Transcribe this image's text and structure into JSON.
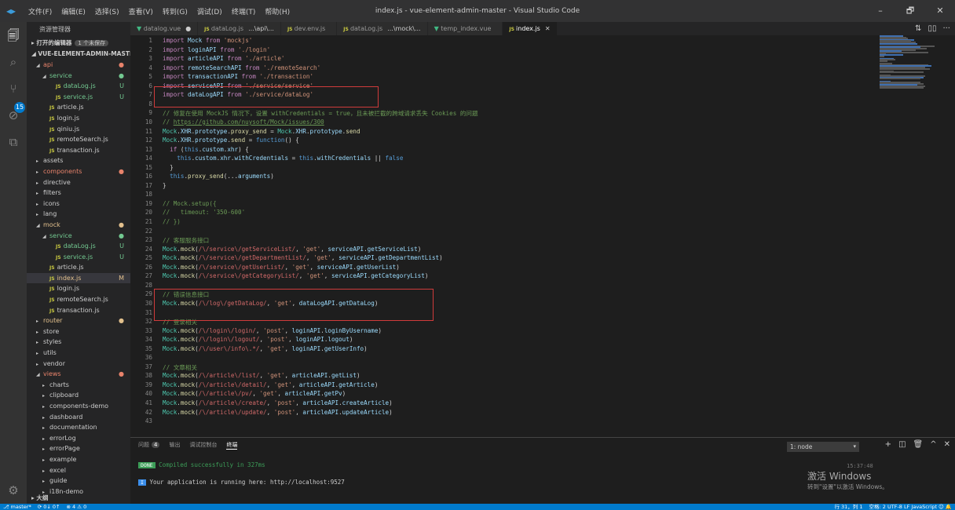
{
  "window": {
    "title": "index.js - vue-element-admin-master - Visual Studio Code",
    "menu": [
      "文件(F)",
      "编辑(E)",
      "选择(S)",
      "查看(V)",
      "转到(G)",
      "调试(D)",
      "终端(T)",
      "帮助(H)"
    ],
    "controls": {
      "minimize": "–",
      "maximize": "🗗",
      "close": "✕"
    }
  },
  "activitybar": {
    "scm_badge": "15"
  },
  "sidebar": {
    "title": "资源管理器",
    "open_editors": "▸ 打开的编辑器",
    "open_editors_badge": "1 个未保存",
    "project": "◢ VUE-ELEMENT-ADMIN-MASTER",
    "items": [
      {
        "label": "api",
        "indent": 1,
        "twisty": "◢",
        "js": false,
        "status": "●",
        "color": "err"
      },
      {
        "label": "service",
        "indent": 2,
        "twisty": "◢",
        "js": false,
        "status": "●",
        "color": "dot"
      },
      {
        "label": "dataLog.js",
        "indent": 3,
        "twisty": "",
        "js": true,
        "status": "U",
        "color": "unt"
      },
      {
        "label": "service.js",
        "indent": 3,
        "twisty": "",
        "js": true,
        "status": "U",
        "color": "unt"
      },
      {
        "label": "article.js",
        "indent": 2,
        "twisty": "",
        "js": true,
        "status": "",
        "color": "plain"
      },
      {
        "label": "login.js",
        "indent": 2,
        "twisty": "",
        "js": true,
        "status": "",
        "color": "plain"
      },
      {
        "label": "qiniu.js",
        "indent": 2,
        "twisty": "",
        "js": true,
        "status": "",
        "color": "plain"
      },
      {
        "label": "remoteSearch.js",
        "indent": 2,
        "twisty": "",
        "js": true,
        "status": "",
        "color": "plain"
      },
      {
        "label": "transaction.js",
        "indent": 2,
        "twisty": "",
        "js": true,
        "status": "",
        "color": "plain"
      },
      {
        "label": "assets",
        "indent": 1,
        "twisty": "▸",
        "js": false,
        "status": "",
        "color": "plain"
      },
      {
        "label": "components",
        "indent": 1,
        "twisty": "▸",
        "js": false,
        "status": "●",
        "color": "err"
      },
      {
        "label": "directive",
        "indent": 1,
        "twisty": "▸",
        "js": false,
        "status": "",
        "color": "plain"
      },
      {
        "label": "filters",
        "indent": 1,
        "twisty": "▸",
        "js": false,
        "status": "",
        "color": "plain"
      },
      {
        "label": "icons",
        "indent": 1,
        "twisty": "▸",
        "js": false,
        "status": "",
        "color": "plain"
      },
      {
        "label": "lang",
        "indent": 1,
        "twisty": "▸",
        "js": false,
        "status": "",
        "color": "plain"
      },
      {
        "label": "mock",
        "indent": 1,
        "twisty": "◢",
        "js": false,
        "status": "●",
        "color": "mod"
      },
      {
        "label": "service",
        "indent": 2,
        "twisty": "◢",
        "js": false,
        "status": "●",
        "color": "dot"
      },
      {
        "label": "dataLog.js",
        "indent": 3,
        "twisty": "",
        "js": true,
        "status": "U",
        "color": "unt"
      },
      {
        "label": "service.js",
        "indent": 3,
        "twisty": "",
        "js": true,
        "status": "U",
        "color": "unt"
      },
      {
        "label": "article.js",
        "indent": 2,
        "twisty": "",
        "js": true,
        "status": "",
        "color": "plain"
      },
      {
        "label": "index.js",
        "indent": 2,
        "twisty": "",
        "js": true,
        "status": "M",
        "color": "mod",
        "active": true
      },
      {
        "label": "login.js",
        "indent": 2,
        "twisty": "",
        "js": true,
        "status": "",
        "color": "plain"
      },
      {
        "label": "remoteSearch.js",
        "indent": 2,
        "twisty": "",
        "js": true,
        "status": "",
        "color": "plain"
      },
      {
        "label": "transaction.js",
        "indent": 2,
        "twisty": "",
        "js": true,
        "status": "",
        "color": "plain"
      },
      {
        "label": "router",
        "indent": 1,
        "twisty": "▸",
        "js": false,
        "status": "●",
        "color": "mod"
      },
      {
        "label": "store",
        "indent": 1,
        "twisty": "▸",
        "js": false,
        "status": "",
        "color": "plain"
      },
      {
        "label": "styles",
        "indent": 1,
        "twisty": "▸",
        "js": false,
        "status": "",
        "color": "plain"
      },
      {
        "label": "utils",
        "indent": 1,
        "twisty": "▸",
        "js": false,
        "status": "",
        "color": "plain"
      },
      {
        "label": "vendor",
        "indent": 1,
        "twisty": "▸",
        "js": false,
        "status": "",
        "color": "plain"
      },
      {
        "label": "views",
        "indent": 1,
        "twisty": "◢",
        "js": false,
        "status": "●",
        "color": "err"
      },
      {
        "label": "charts",
        "indent": 2,
        "twisty": "▸",
        "js": false,
        "status": "",
        "color": "plain"
      },
      {
        "label": "clipboard",
        "indent": 2,
        "twisty": "▸",
        "js": false,
        "status": "",
        "color": "plain"
      },
      {
        "label": "components-demo",
        "indent": 2,
        "twisty": "▸",
        "js": false,
        "status": "",
        "color": "plain"
      },
      {
        "label": "dashboard",
        "indent": 2,
        "twisty": "▸",
        "js": false,
        "status": "",
        "color": "plain"
      },
      {
        "label": "documentation",
        "indent": 2,
        "twisty": "▸",
        "js": false,
        "status": "",
        "color": "plain"
      },
      {
        "label": "errorLog",
        "indent": 2,
        "twisty": "▸",
        "js": false,
        "status": "",
        "color": "plain"
      },
      {
        "label": "errorPage",
        "indent": 2,
        "twisty": "▸",
        "js": false,
        "status": "",
        "color": "plain"
      },
      {
        "label": "example",
        "indent": 2,
        "twisty": "▸",
        "js": false,
        "status": "",
        "color": "plain"
      },
      {
        "label": "excel",
        "indent": 2,
        "twisty": "▸",
        "js": false,
        "status": "",
        "color": "plain"
      },
      {
        "label": "guide",
        "indent": 2,
        "twisty": "▸",
        "js": false,
        "status": "",
        "color": "plain"
      },
      {
        "label": "i18n-demo",
        "indent": 2,
        "twisty": "▸",
        "js": false,
        "status": "",
        "color": "plain"
      }
    ],
    "outline": "▸ 大纲"
  },
  "tabs": [
    {
      "label": "datalog.vue",
      "icon": "vue",
      "suffix": "●",
      "active": false
    },
    {
      "label": "dataLog.js",
      "icon": "js",
      "suffix": "...\\api\\...",
      "active": false
    },
    {
      "label": "dev.env.js",
      "icon": "js",
      "suffix": "",
      "active": false
    },
    {
      "label": "dataLog.js",
      "icon": "js",
      "suffix": "...\\mock\\...",
      "active": false
    },
    {
      "label": "temp_index.vue",
      "icon": "vue",
      "suffix": "",
      "active": false
    },
    {
      "label": "index.js",
      "icon": "js",
      "suffix": "✕",
      "active": true
    }
  ],
  "editor_actions": [
    "⇅",
    "▯▯",
    "···"
  ],
  "code_lines": [
    "<span class=\"k\">import</span> <span class=\"v\">Mock</span> <span class=\"k\">from</span> <span class=\"s\">'mockjs'</span>",
    "<span class=\"k\">import</span> <span class=\"v\">loginAPI</span> <span class=\"k\">from</span> <span class=\"s\">'./login'</span>",
    "<span class=\"k\">import</span> <span class=\"v\">articleAPI</span> <span class=\"k\">from</span> <span class=\"s\">'./article'</span>",
    "<span class=\"k\">import</span> <span class=\"v\">remoteSearchAPI</span> <span class=\"k\">from</span> <span class=\"s\">'./remoteSearch'</span>",
    "<span class=\"k\">import</span> <span class=\"v\">transactionAPI</span> <span class=\"k\">from</span> <span class=\"s\">'./transaction'</span>",
    "<span class=\"k\">import</span> <span class=\"v\">serviceAPI</span> <span class=\"k\">from</span> <span class=\"s\">'./service/service'</span>",
    "<span class=\"k\">import</span> <span class=\"v\">dataLogAPI</span> <span class=\"k\">from</span> <span class=\"s\">'./service/dataLog'</span>",
    "",
    "<span class=\"c\">// 修复在使用 MockJS 情况下，设置 withCredentials = true，且未被拦截的跨域请求丢失 Cookies 的问题</span>",
    "<span class=\"c\">// </span><span class=\"u\">https://github.com/nuysoft/Mock/issues/300</span>",
    "<span class=\"t\">Mock</span>.<span class=\"v\">XHR</span>.<span class=\"v\">prototype</span>.<span class=\"f\">proxy_send</span> = <span class=\"t\">Mock</span>.<span class=\"v\">XHR</span>.<span class=\"v\">prototype</span>.<span class=\"f\">send</span>",
    "<span class=\"t\">Mock</span>.<span class=\"v\">XHR</span>.<span class=\"v\">prototype</span>.<span class=\"f\">send</span> = <span class=\"b\">function</span>() {",
    "  <span class=\"k\">if</span> (<span class=\"b\">this</span>.<span class=\"v\">custom</span>.<span class=\"v\">xhr</span>) {",
    "    <span class=\"b\">this</span>.<span class=\"v\">custom</span>.<span class=\"v\">xhr</span>.<span class=\"v\">withCredentials</span> = <span class=\"b\">this</span>.<span class=\"v\">withCredentials</span> || <span class=\"b\">false</span>",
    "  }",
    "  <span class=\"b\">this</span>.<span class=\"f\">proxy_send</span>(...<span class=\"v\">arguments</span>)",
    "}",
    "",
    "<span class=\"c\">// Mock.setup({</span>",
    "<span class=\"c\">//   timeout: '350-600'</span>",
    "<span class=\"c\">// })</span>",
    "",
    "<span class=\"c\">// 客服服务接口</span>",
    "<span class=\"t\">Mock</span>.<span class=\"f\">mock</span>(<span class=\"r\">/\\/service\\/getServiceList/</span>, <span class=\"s\">'get'</span>, <span class=\"v\">serviceAPI</span>.<span class=\"v\">getServiceList</span>)",
    "<span class=\"t\">Mock</span>.<span class=\"f\">mock</span>(<span class=\"r\">/\\/service\\/getDepartmentList/</span>, <span class=\"s\">'get'</span>, <span class=\"v\">serviceAPI</span>.<span class=\"v\">getDepartmentList</span>)",
    "<span class=\"t\">Mock</span>.<span class=\"f\">mock</span>(<span class=\"r\">/\\/service\\/getUserList/</span>, <span class=\"s\">'get'</span>, <span class=\"v\">serviceAPI</span>.<span class=\"v\">getUserList</span>)",
    "<span class=\"t\">Mock</span>.<span class=\"f\">mock</span>(<span class=\"r\">/\\/service\\/getCategoryList/</span>, <span class=\"s\">'get'</span>, <span class=\"v\">serviceAPI</span>.<span class=\"v\">getCategoryList</span>)",
    "",
    "<span class=\"c\">// 错误信息接口</span>",
    "<span class=\"t\">Mock</span>.<span class=\"f\">mock</span>(<span class=\"r\">/\\/log\\/getDataLog/</span>, <span class=\"s\">'get'</span>, <span class=\"v\">dataLogAPI</span>.<span class=\"v\">getDataLog</span>)",
    "",
    "<span class=\"c\">// 登录相关</span>",
    "<span class=\"t\">Mock</span>.<span class=\"f\">mock</span>(<span class=\"r\">/\\/login\\/login/</span>, <span class=\"s\">'post'</span>, <span class=\"v\">loginAPI</span>.<span class=\"v\">loginByUsername</span>)",
    "<span class=\"t\">Mock</span>.<span class=\"f\">mock</span>(<span class=\"r\">/\\/login\\/logout/</span>, <span class=\"s\">'post'</span>, <span class=\"v\">loginAPI</span>.<span class=\"v\">logout</span>)",
    "<span class=\"t\">Mock</span>.<span class=\"f\">mock</span>(<span class=\"r\">/\\/user\\/info\\.*/</span>, <span class=\"s\">'get'</span>, <span class=\"v\">loginAPI</span>.<span class=\"v\">getUserInfo</span>)",
    "",
    "<span class=\"c\">// 文章相关</span>",
    "<span class=\"t\">Mock</span>.<span class=\"f\">mock</span>(<span class=\"r\">/\\/article\\/list/</span>, <span class=\"s\">'get'</span>, <span class=\"v\">articleAPI</span>.<span class=\"v\">getList</span>)",
    "<span class=\"t\">Mock</span>.<span class=\"f\">mock</span>(<span class=\"r\">/\\/article\\/detail/</span>, <span class=\"s\">'get'</span>, <span class=\"v\">articleAPI</span>.<span class=\"v\">getArticle</span>)",
    "<span class=\"t\">Mock</span>.<span class=\"f\">mock</span>(<span class=\"r\">/\\/article\\/pv/</span>, <span class=\"s\">'get'</span>, <span class=\"v\">articleAPI</span>.<span class=\"v\">getPv</span>)",
    "<span class=\"t\">Mock</span>.<span class=\"f\">mock</span>(<span class=\"r\">/\\/article\\/create/</span>, <span class=\"s\">'post'</span>, <span class=\"v\">articleAPI</span>.<span class=\"v\">createArticle</span>)",
    "<span class=\"t\">Mock</span>.<span class=\"f\">mock</span>(<span class=\"r\">/\\/article\\/update/</span>, <span class=\"s\">'post'</span>, <span class=\"v\">articleAPI</span>.<span class=\"v\">updateArticle</span>)",
    ""
  ],
  "panel": {
    "tabs": [
      "问题",
      "输出",
      "调试控制台",
      "终端"
    ],
    "problems_badge": "4",
    "terminal_select": "1: node",
    "icons": [
      "+",
      "◫",
      "🗑",
      "^",
      "✕"
    ],
    "time": "15:37:48",
    "done_badge": "DONE",
    "compiled": "Compiled successfully in 327ms",
    "info_badge": "I",
    "running": "Your application is running here: http://localhost:9527"
  },
  "watermark": {
    "line1": "激活 Windows",
    "line2": "转到\"设置\"以激活 Windows。"
  },
  "statusbar": {
    "branch": "⎇ master*",
    "sync": "⟳ 0↓ 0↑",
    "problems": "⊗ 4 ⚠ 0",
    "position": "行 31，列 1",
    "right_rest": "空格: 2  UTF-8  LF  JavaScript  ☺  🔔"
  }
}
